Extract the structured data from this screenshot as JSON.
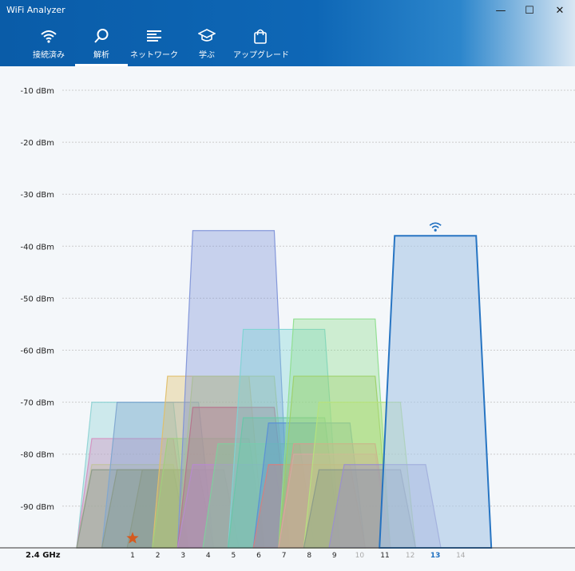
{
  "app": {
    "title": "WiFi Analyzer"
  },
  "window_controls": {
    "minimize": "—",
    "maximize": "☐",
    "close": "✕"
  },
  "nav": [
    {
      "label": "接続済み",
      "icon": "wifi-icon"
    },
    {
      "label": "解析",
      "icon": "search-icon",
      "active": true
    },
    {
      "label": "ネットワーク",
      "icon": "list-icon"
    },
    {
      "label": "学ぶ",
      "icon": "graduation-cap-icon"
    },
    {
      "label": "アップグレード",
      "icon": "shopping-bag-icon"
    }
  ],
  "chart_data": {
    "type": "area",
    "band_label": "2.4 GHz",
    "y_tick_labels": [
      "-10 dBm",
      "-20 dBm",
      "-30 dBm",
      "-40 dBm",
      "-50 dBm",
      "-60 dBm",
      "-70 dBm",
      "-80 dBm",
      "-90 dBm"
    ],
    "x_tick_labels": [
      "1",
      "2",
      "3",
      "4",
      "5",
      "6",
      "7",
      "8",
      "9",
      "10",
      "11",
      "12",
      "13",
      "14"
    ],
    "ylim": [
      -99,
      -5
    ],
    "grid": true,
    "connected_channel": 13,
    "favorite_channel": 1,
    "networks": [
      {
        "channel": 1,
        "signal": -70,
        "color": "#8fd3d4"
      },
      {
        "channel": 1,
        "signal": -77,
        "color": "#d58fc0"
      },
      {
        "channel": 1,
        "signal": -82,
        "color": "#c3c3a0"
      },
      {
        "channel": 1,
        "signal": -83,
        "color": "#8a9a8a"
      },
      {
        "channel": 2,
        "signal": -70,
        "color": "#7fa6d0"
      },
      {
        "channel": 2,
        "signal": -83,
        "color": "#8a9a8a"
      },
      {
        "channel": 3,
        "signal": -83,
        "color": "#8a9a8a"
      },
      {
        "channel": 4,
        "signal": -65,
        "color": "#e0bf6a"
      },
      {
        "channel": 4,
        "signal": -77,
        "color": "#9fcf7d"
      },
      {
        "channel": 5,
        "signal": -65,
        "color": "#c7d874"
      },
      {
        "channel": 5,
        "signal": -37,
        "color": "#7f94d8"
      },
      {
        "channel": 5,
        "signal": -71,
        "color": "#b6748c"
      },
      {
        "channel": 5,
        "signal": -82,
        "color": "#b78acf"
      },
      {
        "channel": 6,
        "signal": -78,
        "color": "#7fcf9d"
      },
      {
        "channel": 7,
        "signal": -56,
        "color": "#7fd4d4"
      },
      {
        "channel": 7,
        "signal": -73,
        "color": "#69c6a9"
      },
      {
        "channel": 8,
        "signal": -74,
        "color": "#5a8fd6"
      },
      {
        "channel": 8,
        "signal": -82,
        "color": "#d6807e"
      },
      {
        "channel": 9,
        "signal": -54,
        "color": "#8fde8f"
      },
      {
        "channel": 9,
        "signal": -65,
        "color": "#9dd06a"
      },
      {
        "channel": 9,
        "signal": -78,
        "color": "#d69a8f"
      },
      {
        "channel": 9,
        "signal": -80,
        "color": "#d6a8a0"
      },
      {
        "channel": 10,
        "signal": -70,
        "color": "#b6e27d"
      },
      {
        "channel": 10,
        "signal": -83,
        "color": "#8a9a8a"
      },
      {
        "channel": 11,
        "signal": -82,
        "color": "#9a8fcf"
      },
      {
        "channel": 13,
        "signal": -38,
        "color": "#1e6fc0"
      }
    ],
    "colors": {
      "connected": "#1e6fc0",
      "favorite_star": "#d55a1e",
      "grid": "#cccccc"
    }
  }
}
